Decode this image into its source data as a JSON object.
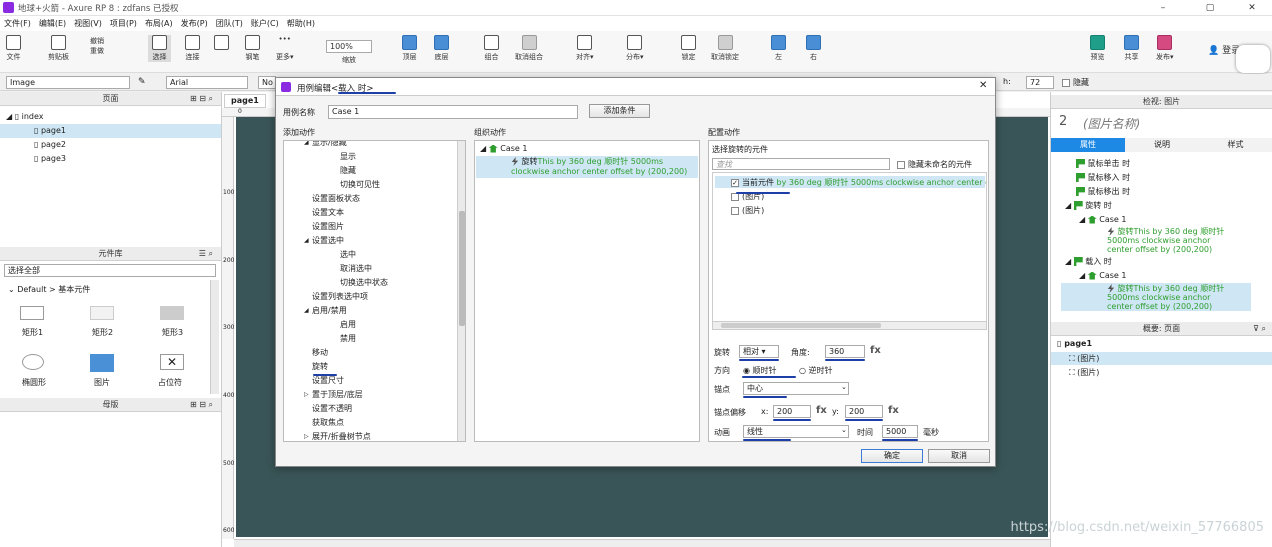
{
  "window": {
    "title": "地球+火箭 - Axure RP 8 : zdfans 已授权",
    "minimize": "–",
    "maximize": "▢",
    "close": "✕"
  },
  "menu": [
    "文件(F)",
    "编辑(E)",
    "视图(V)",
    "项目(P)",
    "布局(A)",
    "发布(P)",
    "团队(T)",
    "账户(C)",
    "帮助(H)"
  ],
  "toolbar": {
    "file": "文件",
    "clipboard": "剪贴板",
    "cut": "✂",
    "undo": "撤销",
    "redo": "重做",
    "select": "选择",
    "connect": "连接",
    "pen": "钢笔",
    "more": "更多▾",
    "zoom_value": "100%",
    "zoom_label": "缩放",
    "top": "顶层",
    "bottom": "底层",
    "group": "组合",
    "ungroup": "取消组合",
    "align": "对齐▾",
    "distribute": "分布▾",
    "lock": "锁定",
    "unlock": "取消锁定",
    "left": "左",
    "right": "右",
    "preview": "预览",
    "share": "共享",
    "publish": "发布▾",
    "login": "登录"
  },
  "stylebar": {
    "widget_type": "Image",
    "font": "Arial",
    "normal_prefix": "No",
    "height_label": "h:",
    "height_value": "72",
    "hide_label": "隐藏"
  },
  "pages_panel": {
    "title": "页面",
    "root": "index",
    "items": [
      "page1",
      "page2",
      "page3"
    ]
  },
  "library_panel": {
    "title": "元件库",
    "select": "选择全部",
    "group": "Default > 基本元件",
    "widgets": [
      "矩形1",
      "矩形2",
      "矩形3",
      "椭圆形",
      "图片",
      "占位符"
    ]
  },
  "masters_panel": {
    "title": "母版"
  },
  "canvas": {
    "tab": "page1",
    "ruler_top": [
      "0"
    ],
    "ruler_left": [
      "100",
      "200",
      "300",
      "400",
      "500",
      "600"
    ]
  },
  "inspector": {
    "title": "检视: 图片",
    "widget_number": "2",
    "widget_name": "(图片名称)",
    "tabs": [
      "属性",
      "说明",
      "样式"
    ],
    "events": [
      {
        "type": "event",
        "label": "鼠标单击 时"
      },
      {
        "type": "event",
        "label": "鼠标移入 时"
      },
      {
        "type": "event",
        "label": "鼠标移出 时"
      },
      {
        "type": "event",
        "label": "旋转 时"
      },
      {
        "type": "case",
        "label": "Case 1"
      },
      {
        "type": "action",
        "label": "旋转This by 360 deg 顺时针 5000ms clockwise anchor center offset by (200,200)"
      },
      {
        "type": "event",
        "label": "载入 时"
      },
      {
        "type": "case",
        "label": "Case 1"
      },
      {
        "type": "action",
        "label": "旋转This by 360 deg 顺时针 5000ms clockwise anchor center offset by (200,200)"
      }
    ]
  },
  "outline_panel": {
    "title": "概要: 页面",
    "root": "page1",
    "items": [
      "(图片)",
      "(图片)"
    ]
  },
  "dialog": {
    "title": "用例编辑<载入 时>",
    "case_name_label": "用例名称",
    "case_name": "Case 1",
    "add_condition": "添加条件",
    "col_add_action": "添加动作",
    "col_organize": "组织动作",
    "col_configure": "配置动作",
    "actions": [
      {
        "label": "显示/隐藏",
        "indent": 1,
        "expand": "◢"
      },
      {
        "label": "显示",
        "indent": 2
      },
      {
        "label": "隐藏",
        "indent": 2
      },
      {
        "label": "切换可见性",
        "indent": 2
      },
      {
        "label": "设置面板状态",
        "indent": 1
      },
      {
        "label": "设置文本",
        "indent": 1
      },
      {
        "label": "设置图片",
        "indent": 1
      },
      {
        "label": "设置选中",
        "indent": 1,
        "expand": "◢"
      },
      {
        "label": "选中",
        "indent": 2
      },
      {
        "label": "取消选中",
        "indent": 2
      },
      {
        "label": "切换选中状态",
        "indent": 2
      },
      {
        "label": "设置列表选中项",
        "indent": 1
      },
      {
        "label": "启用/禁用",
        "indent": 1,
        "expand": "◢"
      },
      {
        "label": "启用",
        "indent": 2
      },
      {
        "label": "禁用",
        "indent": 2
      },
      {
        "label": "移动",
        "indent": 1
      },
      {
        "label": "旋转",
        "indent": 1
      },
      {
        "label": "设置尺寸",
        "indent": 1
      },
      {
        "label": "置于顶层/底层",
        "indent": 1,
        "expand": "▷"
      },
      {
        "label": "设置不透明",
        "indent": 1
      },
      {
        "label": "获取焦点",
        "indent": 1
      },
      {
        "label": "展开/折叠树节点",
        "indent": 1,
        "expand": "▷"
      }
    ],
    "organize": {
      "case": "Case 1",
      "action_name": "旋转",
      "action_detail": "This by 360 deg 顺时针 5000ms clockwise anchor center offset by (200,200)"
    },
    "configure": {
      "select_label": "选择旋转的元件",
      "search_placeholder": "查找",
      "hide_unnamed": "隐藏未命名的元件",
      "targets": [
        {
          "checked": true,
          "name": "当前元件",
          "detail": " by 360 deg 顺时针 5000ms clockwise anchor center of"
        },
        {
          "checked": false,
          "name": "(图片)",
          "detail": ""
        },
        {
          "checked": false,
          "name": "(图片)",
          "detail": ""
        }
      ],
      "rotate_label": "旋转",
      "rotate_mode": "相对 ▾",
      "angle_label": "角度:",
      "angle_value": "360",
      "fx": "fx",
      "direction_label": "方向",
      "cw": "顺时针",
      "ccw": "逆时针",
      "anchor_label": "锚点",
      "anchor_value": "中心",
      "offset_label": "锚点偏移",
      "x_label": "x:",
      "x_value": "200",
      "y_label": "y:",
      "y_value": "200",
      "anim_label": "动画",
      "anim_value": "线性",
      "time_label": "时间",
      "time_value": "5000",
      "ms": "毫秒"
    },
    "ok": "确定",
    "cancel": "取消"
  },
  "watermark": "https://blog.csdn.net/weixin_57766805"
}
